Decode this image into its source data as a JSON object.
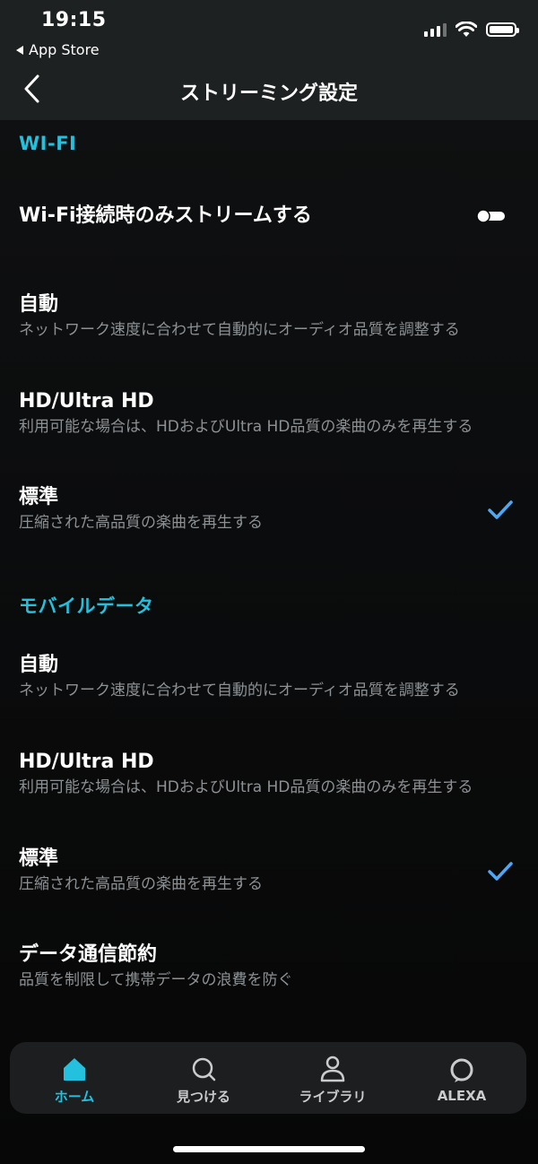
{
  "status_bar": {
    "time": "19:15",
    "back_app": "App Store"
  },
  "header": {
    "title": "ストリーミング設定"
  },
  "wifi_section": {
    "label": "WI-FI",
    "toggle_row": {
      "title": "Wi-Fi接続時のみストリームする",
      "toggle_state": "off"
    },
    "options": [
      {
        "title": "自動",
        "subtitle": "ネットワーク速度に合わせて自動的にオーディオ品質を調整する",
        "selected": false
      },
      {
        "title": "HD/Ultra HD",
        "subtitle": "利用可能な場合は、HDおよびUltra HD品質の楽曲のみを再生する",
        "selected": false
      },
      {
        "title": "標準",
        "subtitle": "圧縮された高品質の楽曲を再生する",
        "selected": true
      }
    ]
  },
  "mobile_section": {
    "label": "モバイルデータ",
    "options": [
      {
        "title": "自動",
        "subtitle": "ネットワーク速度に合わせて自動的にオーディオ品質を調整する",
        "selected": false
      },
      {
        "title": "HD/Ultra HD",
        "subtitle": "利用可能な場合は、HDおよびUltra HD品質の楽曲のみを再生する",
        "selected": false
      },
      {
        "title": "標準",
        "subtitle": "圧縮された高品質の楽曲を再生する",
        "selected": true
      },
      {
        "title": "データ通信節約",
        "subtitle": "品質を制限して携帯データの浪費を防ぐ",
        "selected": false
      }
    ]
  },
  "tabbar": {
    "tabs": [
      {
        "label": "ホーム",
        "icon": "home-icon",
        "active": true
      },
      {
        "label": "見つける",
        "icon": "search-icon",
        "active": false
      },
      {
        "label": "ライブラリ",
        "icon": "person-icon",
        "active": false
      },
      {
        "label": "ALEXA",
        "icon": "alexa-icon",
        "active": false
      }
    ]
  },
  "colors": {
    "accent": "#24c1de",
    "check": "#4ea7f2",
    "subtitle": "#8d9194",
    "header_bg": "#1e2122"
  }
}
